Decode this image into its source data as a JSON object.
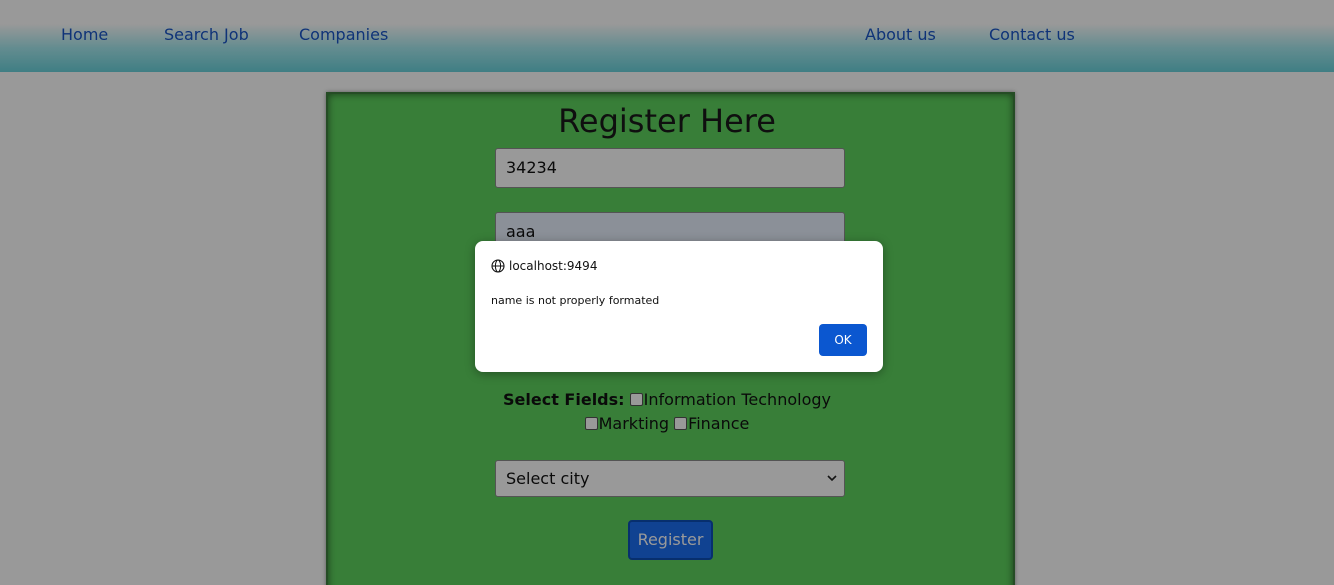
{
  "nav": {
    "home": "Home",
    "search_job": "Search Job",
    "companies": "Companies",
    "about": "About us",
    "contact": "Contact us"
  },
  "form": {
    "title": "Register Here",
    "field1_value": "34234",
    "field2_value": "aaa",
    "fields_label": "Select Fields:",
    "options": [
      "Information Technology",
      "Markting",
      "Finance"
    ],
    "city_selected": "Select city",
    "register_label": "Register"
  },
  "dialog": {
    "origin": "localhost:9494",
    "message": "name is not properly formated",
    "ok_label": "OK"
  },
  "colors": {
    "card_bg": "#5ed35e",
    "nav_gradient_end": "#6ad3dc",
    "link": "#1a56c8",
    "primary_button": "#1c6ef2",
    "dialog_ok": "#0b57d0"
  },
  "icons": {
    "dialog_origin": "globe-icon",
    "select_arrow": "chevron-down-icon"
  }
}
